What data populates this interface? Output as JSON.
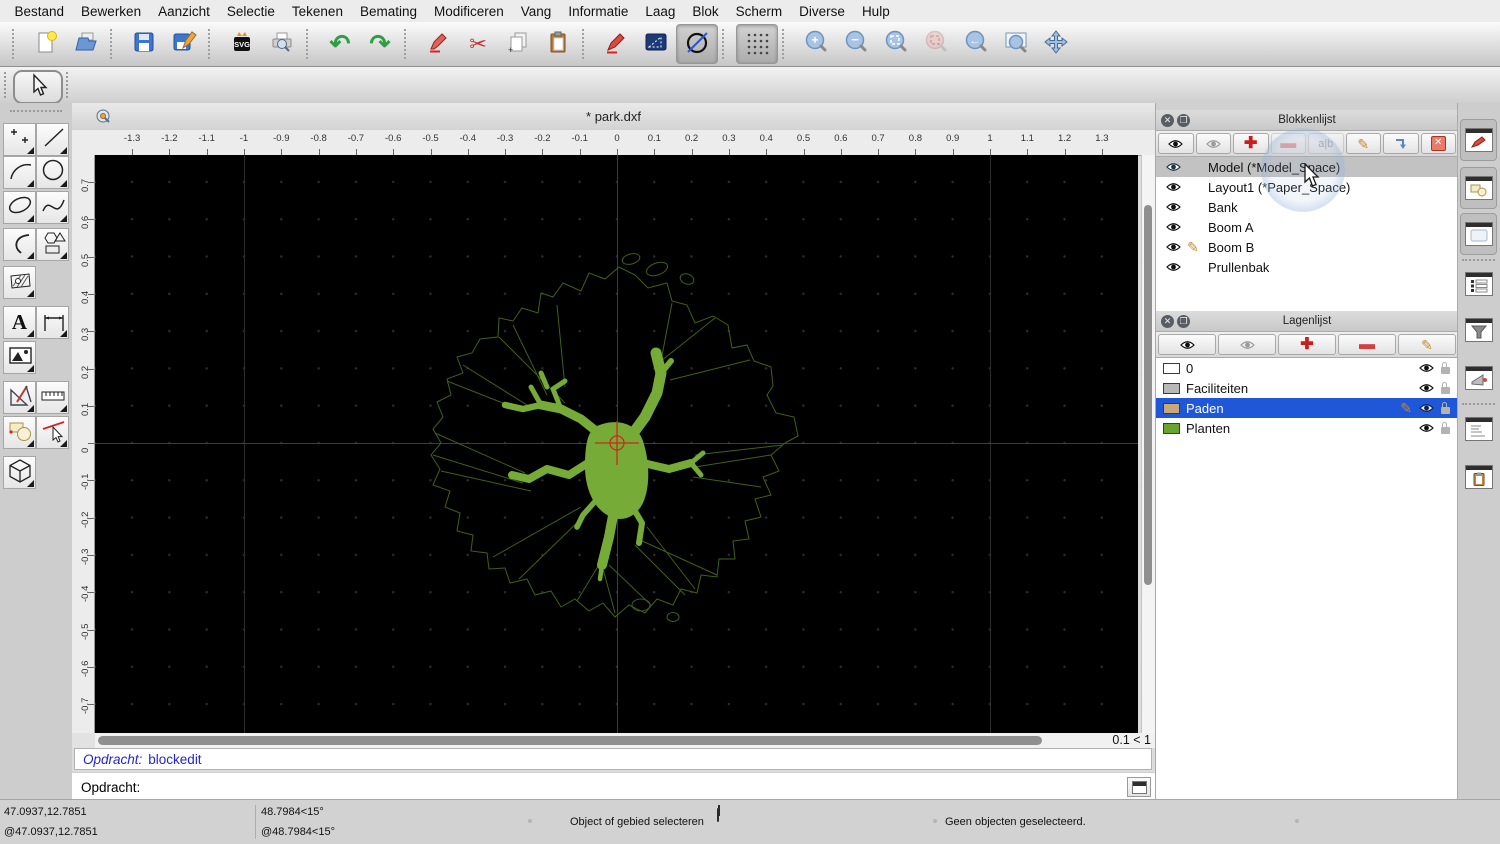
{
  "menu": {
    "items": [
      "Bestand",
      "Bewerken",
      "Aanzicht",
      "Selectie",
      "Tekenen",
      "Bemating",
      "Modificeren",
      "Vang",
      "Informatie",
      "Laag",
      "Blok",
      "Scherm",
      "Diverse",
      "Hulp"
    ]
  },
  "toolbar": {
    "icons": [
      "new-file",
      "open-file",
      "save",
      "save-as",
      "svg-export",
      "print-preview",
      "undo",
      "redo",
      "erase",
      "cut",
      "copy",
      "paste",
      "draw-pencil",
      "ortho-restrict",
      "circle-line-toggle",
      "grid-toggle",
      "zoom-in",
      "zoom-out",
      "zoom-auto",
      "zoom-selection",
      "zoom-previous",
      "zoom-window",
      "pan"
    ],
    "svg_label": "SVG"
  },
  "left_toolbar": {
    "tools": [
      "selection",
      "points",
      "line",
      "arc",
      "circle",
      "ellipse",
      "spline",
      "polyline",
      "shapes",
      "hatch",
      "text",
      "dimension",
      "image",
      "drafting-tools",
      "measure",
      "modify",
      "divide",
      "solid"
    ]
  },
  "document": {
    "tab_title": "* park.dxf",
    "grid_status": "0.1 < 1"
  },
  "rulers": {
    "horizontal": [
      "-1.3",
      "-1.2",
      "-1.1",
      "-1",
      "-0.9",
      "-0.8",
      "-0.7",
      "-0.6",
      "-0.5",
      "-0.4",
      "-0.3",
      "-0.2",
      "-0.1",
      "0",
      "0.1",
      "0.2",
      "0.3",
      "0.4",
      "0.5",
      "0.6",
      "0.7",
      "0.8",
      "0.9",
      "1",
      "1.1",
      "1.2",
      "1.3"
    ],
    "vertical": [
      "0.7",
      "0.6",
      "0.5",
      "0.4",
      "0.3",
      "0.2",
      "0.1",
      "0",
      "-0.1",
      "-0.2",
      "-0.3",
      "-0.4",
      "-0.5",
      "-0.6",
      "-0.7"
    ]
  },
  "blocks_panel": {
    "title": "Blokkenlijst",
    "rename_label": "a|b",
    "items": [
      {
        "name": "Model (*Model_Space)",
        "selected": true
      },
      {
        "name": "Layout1 (*Paper_Space)"
      },
      {
        "name": "Bank"
      },
      {
        "name": "Boom A"
      },
      {
        "name": "Boom B",
        "editing": true
      },
      {
        "name": "Prullenbak"
      }
    ]
  },
  "layers_panel": {
    "title": "Lagenlijst",
    "items": [
      {
        "name": "0",
        "color": "#ffffff"
      },
      {
        "name": "Faciliteiten",
        "color": "#b8b8b8"
      },
      {
        "name": "Paden",
        "color": "#c9a878",
        "selected": true,
        "editing": true
      },
      {
        "name": "Planten",
        "color": "#6aa32f"
      }
    ]
  },
  "command": {
    "history_label": "Opdracht:",
    "history_value": "blockedit",
    "prompt_label": "Opdracht:",
    "prompt_value": ""
  },
  "status_bar": {
    "coord_abs": "47.0937,12.7851",
    "coord_rel": "@47.0937,12.7851",
    "polar_abs": "48.7984<15°",
    "polar_rel": "@48.7984<15°",
    "hint": "Object of gebied selecteren",
    "selection": "Geen objecten geselecteerd."
  },
  "colors": {
    "canvas_background": "#000000",
    "tree_fill": "#76ab37",
    "tree_outline": "#405f20",
    "selection_blue": "#2056d8",
    "selected_block_gray": "#c2c2c2",
    "origin_marker_red": "#cd2a1a",
    "command_text_blue": "#2424d6"
  }
}
